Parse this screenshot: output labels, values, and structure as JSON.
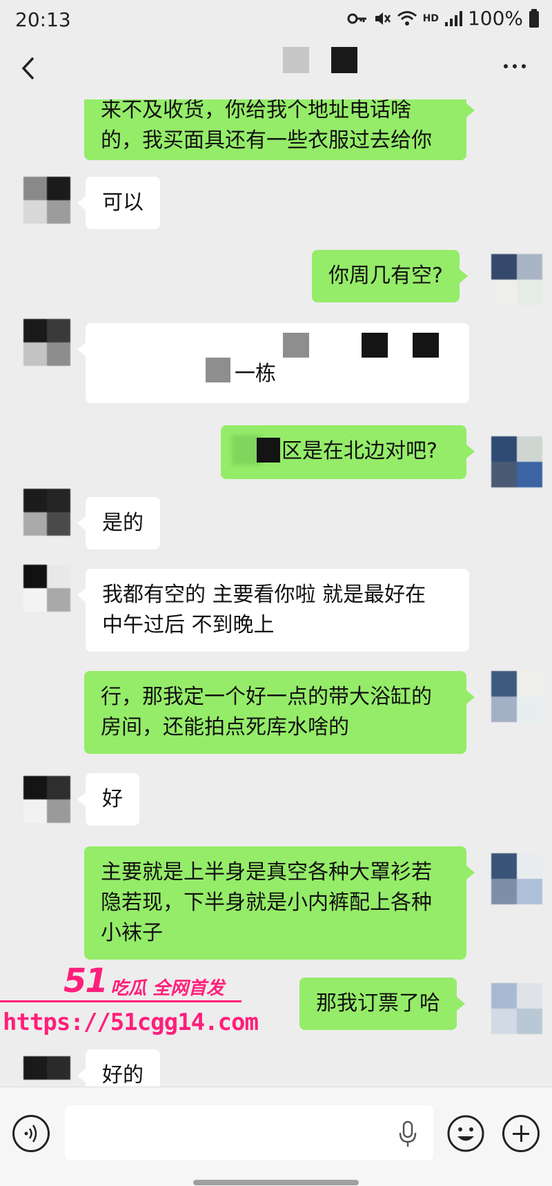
{
  "status_bar": {
    "time": "20:13",
    "battery": "100%",
    "hd_label": "HD"
  },
  "nav": {
    "back_icon": "chevron-left-icon",
    "more_icon": "more-dots-icon"
  },
  "messages": [
    {
      "side": "out",
      "text": "来不及收货，你给我个地址电话啥",
      "text2": "的，我买面具还有一些衣服过去给你"
    },
    {
      "side": "in",
      "text": "可以"
    },
    {
      "side": "out",
      "text": "你周几有空?"
    },
    {
      "side": "in",
      "text": "一栋"
    },
    {
      "side": "out",
      "text": "区是在北边对吧?"
    },
    {
      "side": "in",
      "text": "是的"
    },
    {
      "side": "in",
      "text": "我都有空的 主要看你啦 就是最好在",
      "text2": "中午过后 不到晚上"
    },
    {
      "side": "out",
      "text": "行，那我定一个好一点的带大浴缸的",
      "text2": "房间，还能拍点死库水啥的"
    },
    {
      "side": "in",
      "text": "好"
    },
    {
      "side": "out",
      "text": "主要就是上半身是真空各种大罩衫若",
      "text2": "隐若现，下半身就是小内裤配上各种",
      "text3": "小袜子"
    },
    {
      "side": "out",
      "text": "那我订票了哈"
    },
    {
      "side": "in",
      "text": "好的"
    }
  ],
  "watermark": {
    "logo": "51",
    "tagline": "吃瓜 全网首发",
    "url": "https://51cgg14.com"
  },
  "input_bar": {
    "voice_icon": "voice-icon",
    "mic_icon": "mic-icon",
    "emoji_icon": "emoji-icon",
    "plus_icon": "plus-icon"
  },
  "colors": {
    "background": "#ededed",
    "outgoing_bubble": "#95ec69",
    "incoming_bubble": "#ffffff",
    "watermark": "#ff1f7a"
  }
}
